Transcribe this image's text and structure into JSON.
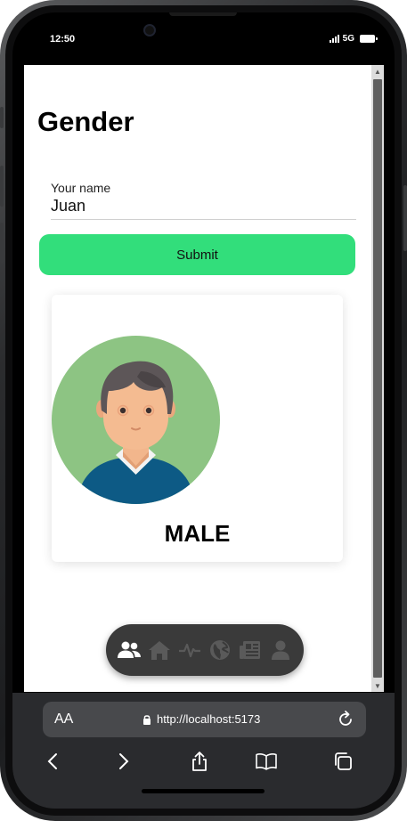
{
  "status": {
    "time": "12:50",
    "network": "5G"
  },
  "page": {
    "title": "Gender",
    "name_field": {
      "label": "Your name",
      "value": "Juan"
    },
    "submit_label": "Submit",
    "result": {
      "gender": "MALE",
      "avatar_icon": "male-avatar-icon"
    }
  },
  "bottom_nav": {
    "items": [
      {
        "name": "people-icon",
        "active": true
      },
      {
        "name": "home-icon",
        "active": false
      },
      {
        "name": "pulse-icon",
        "active": false
      },
      {
        "name": "globe-icon",
        "active": false
      },
      {
        "name": "news-icon",
        "active": false
      },
      {
        "name": "person-icon",
        "active": false
      }
    ]
  },
  "browser": {
    "aa_label": "AA",
    "url": "http://localhost:5173"
  },
  "colors": {
    "accent": "#32de7b",
    "nav_bg": "#3a3a3a",
    "nav_active": "#ffffff",
    "nav_inactive": "#5a5a5a",
    "avatar_bg": "#8dc483"
  }
}
